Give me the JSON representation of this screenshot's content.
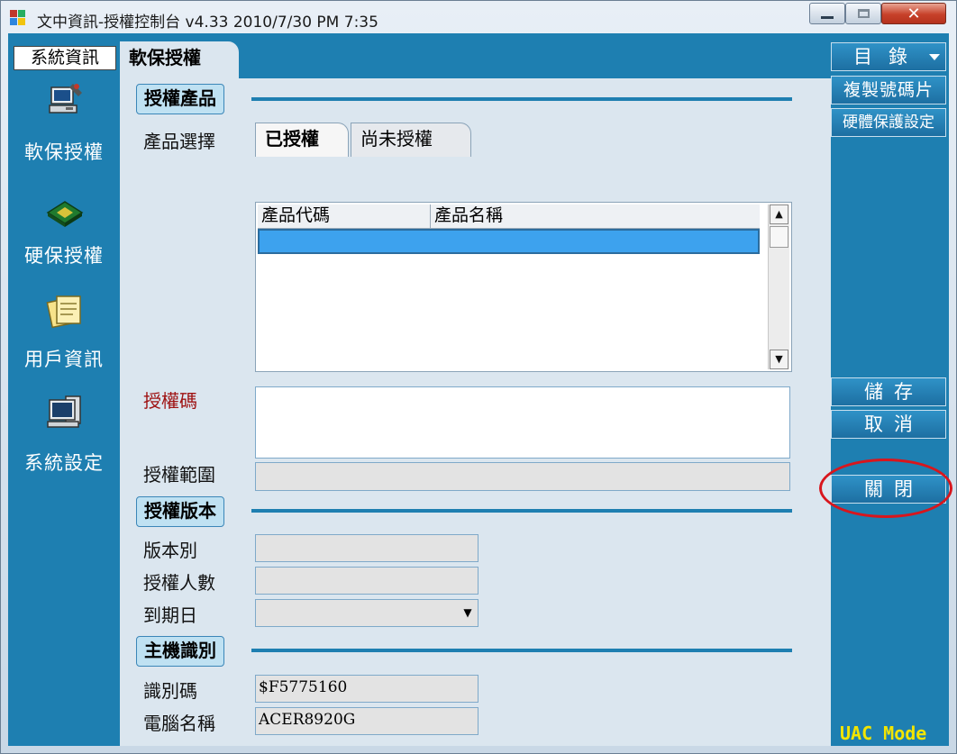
{
  "window": {
    "title": "文中資訊-授權控制台  v4.33  2010/7/30  PM 7:35",
    "controls": [
      "minimize",
      "maximize",
      "close"
    ]
  },
  "sidebar": {
    "header_tab": "系統資訊",
    "items": [
      {
        "label": "軟保授權",
        "icon": "computer-shield-icon"
      },
      {
        "label": "硬保授權",
        "icon": "chip-icon"
      },
      {
        "label": "用戶資訊",
        "icon": "notes-icon"
      },
      {
        "label": "系統設定",
        "icon": "monitor-icon"
      }
    ]
  },
  "main": {
    "active_tab": "軟保授權",
    "sections": {
      "product": {
        "title": "授權產品",
        "select_label": "產品選擇",
        "tabs": [
          "已授權",
          "尚未授權"
        ],
        "columns": [
          "產品代碼",
          "產品名稱"
        ],
        "rows": [
          {
            "code": "",
            "name": ""
          }
        ]
      },
      "auth_code_label": "授權碼",
      "auth_code_value": "",
      "scope_label": "授權範圍",
      "scope_value": "",
      "version": {
        "title": "授權版本",
        "edition_label": "版本別",
        "edition_value": "",
        "users_label": "授權人數",
        "users_value": "",
        "expiry_label": "到期日",
        "expiry_value": ""
      },
      "host": {
        "title": "主機識別",
        "id_label": "識別碼",
        "id_value": "$F5775160",
        "pc_label": "電腦名稱",
        "pc_value": "ACER8920G"
      }
    }
  },
  "toolbar": {
    "menu_label": "目錄",
    "copy_serial": "複製號碼片",
    "hw_setting": "硬體保護設定",
    "save": "儲存",
    "cancel": "取消",
    "close": "關閉",
    "uac": "UAC Mode"
  },
  "colors": {
    "panel_blue": "#1e7fb1",
    "panel_light": "#dbe6ef",
    "highlight": "#d8161d",
    "uac_text": "#f2e500"
  }
}
